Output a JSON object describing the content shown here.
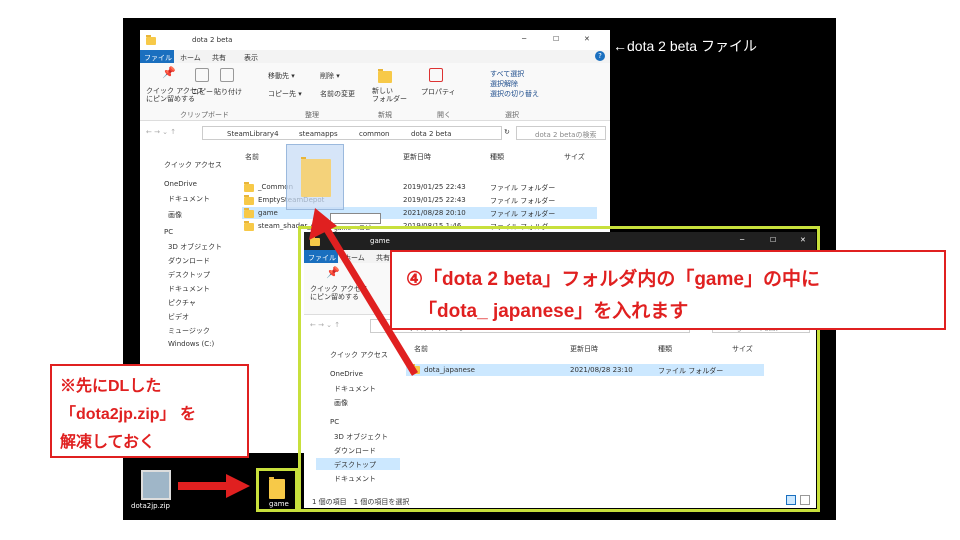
{
  "annotations": {
    "file_label": "←dota 2 beta ファイル",
    "instruction_line1": "④「dota 2 beta」フォルダ内の「game」の中に",
    "instruction_line2": "「dota_ japanese」を入れます",
    "note_line1": "※先にDLした",
    "note_line2": "「dota2jp.zip」 を",
    "note_line3": "解凍しておく",
    "copy_tooltip": "game へコピー",
    "accent_red": "#e02020",
    "highlight_yellow": "#c8e03c"
  },
  "back_window": {
    "title": "dota 2 beta",
    "title_controls": [
      "─",
      "☐",
      "✕"
    ],
    "tabs": [
      "ファイル",
      "ホーム",
      "共有",
      "表示"
    ],
    "ribbon": {
      "pin_label": "クイック アクセス\nにピン留めする",
      "copy_label": "コピー",
      "paste_label": "貼り付け",
      "group_clipboard": "クリップボード",
      "move_to": "移動先 ▾",
      "copy_to": "コピー先 ▾",
      "delete": "削除 ▾",
      "rename": "名前の変更",
      "group_organize": "整理",
      "new_folder": "新しい\nフォルダー",
      "group_new": "新規",
      "properties": "プロパティ",
      "group_open": "開く",
      "select_all": "すべて選択",
      "select_none": "選択解除",
      "invert_select": "選択の切り替え",
      "group_select": "選択"
    },
    "address": {
      "path": [
        "SteamLibrary4",
        "steamapps",
        "common",
        "dota 2 beta"
      ],
      "search_placeholder": "dota 2 betaの検索"
    },
    "nav": [
      "クイック アクセス",
      "OneDrive",
      "ドキュメント",
      "画像",
      "PC",
      "3D オブジェクト",
      "ダウンロード",
      "デスクトップ",
      "ドキュメント",
      "ピクチャ",
      "ビデオ",
      "ミュージック",
      "Windows (C:)"
    ],
    "columns": [
      "名前",
      "更新日時",
      "種類",
      "サイズ"
    ],
    "rows": [
      {
        "name": "_Common",
        "date": "2019/01/25 22:43",
        "type": "ファイル フォルダー"
      },
      {
        "name": "EmptySteamDepot",
        "date": "2019/01/25 22:43",
        "type": "ファイル フォルダー"
      },
      {
        "name": "game",
        "date": "2021/08/28 20:10",
        "type": "ファイル フォルダー"
      },
      {
        "name": "steam_shader_cache",
        "date": "2019/08/15 1:46",
        "type": "ファイル フォルダー"
      }
    ]
  },
  "front_window": {
    "title": "game",
    "title_controls": [
      "─",
      "☐",
      "✕"
    ],
    "tabs": [
      "ファイル",
      "ホーム",
      "共有"
    ],
    "pin_label": "クイック アクセス\nにピン留めする",
    "address": {
      "path": [
        "PC",
        "デスクトップ",
        "game"
      ],
      "search_placeholder": "gameの検索"
    },
    "nav": [
      "クイック アクセス",
      "OneDrive",
      "ドキュメント",
      "画像",
      "PC",
      "3D オブジェクト",
      "ダウンロード",
      "デスクトップ",
      "ドキュメント"
    ],
    "columns": [
      "名前",
      "更新日時",
      "種類",
      "サイズ"
    ],
    "rows": [
      {
        "name": "dota_japanese",
        "date": "2021/08/28 23:10",
        "type": "ファイル フォルダー"
      }
    ],
    "status": "1 個の項目　1 個の項目を選択"
  },
  "desktop": {
    "zip_label": "dota2jp.zip",
    "folder_label": "game"
  }
}
